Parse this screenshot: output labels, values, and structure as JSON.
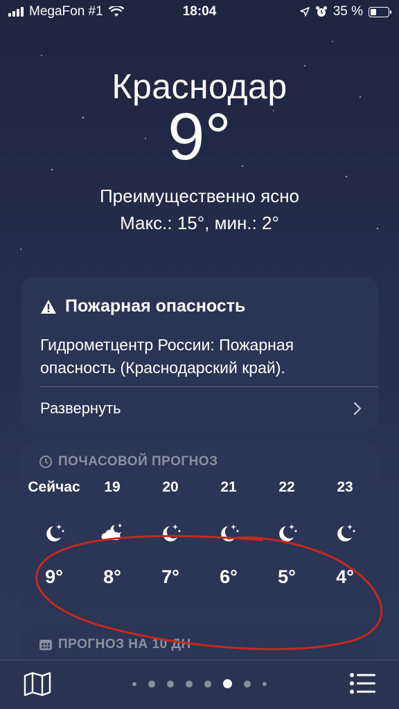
{
  "status_bar": {
    "carrier": "MegaFon #1",
    "time": "18:04",
    "battery": "35 %"
  },
  "weather": {
    "city": "Краснодар",
    "temperature": "9°",
    "condition": "Преимущественно ясно",
    "hi_lo": "Макс.: 15°, мин.: 2°"
  },
  "alert": {
    "title": "Пожарная опасность",
    "body": "Гидрометцентр России: Пожарная опасность (Краснодарский край).",
    "expand_label": "Развернуть"
  },
  "hourly": {
    "title": "ПОЧАСОВОЙ ПРОГНОЗ",
    "items": [
      {
        "label": "Сейчас",
        "icon": "moon-stars-icon",
        "temp": "9°"
      },
      {
        "label": "19",
        "icon": "partly-cloudy-night-icon",
        "temp": "8°"
      },
      {
        "label": "20",
        "icon": "moon-stars-icon",
        "temp": "7°"
      },
      {
        "label": "21",
        "icon": "moon-stars-icon",
        "temp": "6°"
      },
      {
        "label": "22",
        "icon": "moon-stars-icon",
        "temp": "5°"
      },
      {
        "label": "23",
        "icon": "moon-stars-icon",
        "temp": "4°"
      }
    ]
  },
  "forecast": {
    "title": "ПРОГНОЗ НА 10 ДН"
  },
  "pager": {
    "count": 8,
    "active_index": 5
  },
  "colors": {
    "annotation_stroke": "#c8281e"
  }
}
